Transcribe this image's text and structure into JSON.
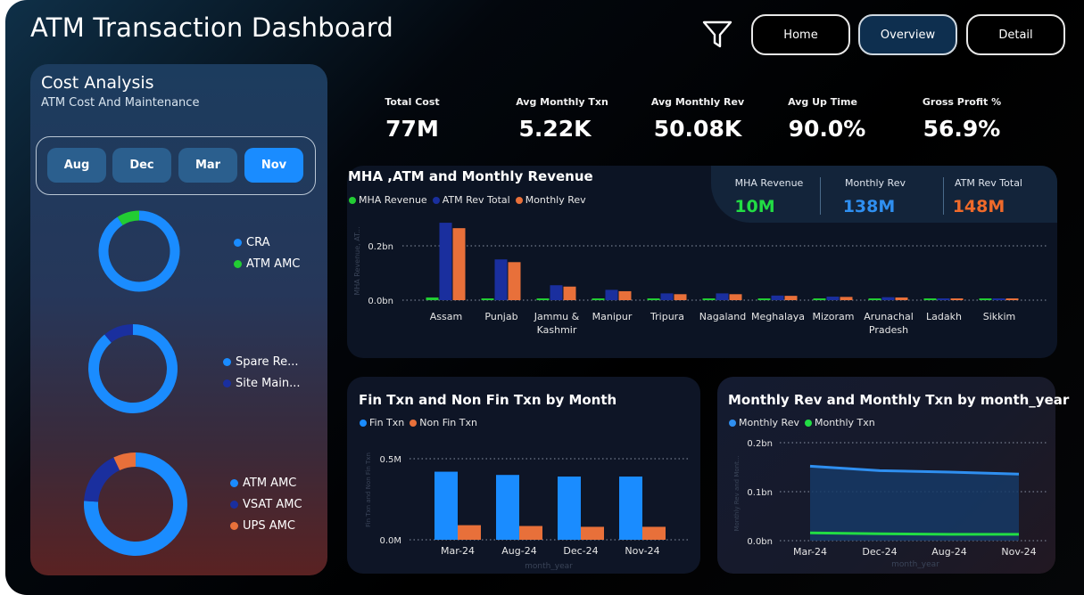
{
  "header": {
    "title": "ATM Transaction Dashboard",
    "filter_icon": "filter-icon",
    "nav": [
      {
        "label": "Home",
        "active": false
      },
      {
        "label": "Overview",
        "active": true
      },
      {
        "label": "Detail",
        "active": false
      }
    ]
  },
  "cost_panel": {
    "title": "Cost Analysis",
    "subtitle": "ATM Cost And Maintenance",
    "months": [
      {
        "label": "Aug",
        "selected": false
      },
      {
        "label": "Dec",
        "selected": false
      },
      {
        "label": "Mar",
        "selected": false
      },
      {
        "label": "Nov",
        "selected": true
      }
    ],
    "donuts": [
      {
        "legend": [
          {
            "label": "CRA",
            "color": "#1a8cff"
          },
          {
            "label": "ATM AMC",
            "color": "#22cc33"
          }
        ],
        "slices": [
          {
            "label": "CRA",
            "value": 0.91,
            "color": "#1a8cff"
          },
          {
            "label": "ATM AMC",
            "value": 0.09,
            "color": "#22cc33"
          }
        ]
      },
      {
        "legend": [
          {
            "label": "Spare Re...",
            "color": "#1a8cff"
          },
          {
            "label": "Site Main...",
            "color": "#1a2f9e"
          }
        ],
        "slices": [
          {
            "label": "Spare Re...",
            "value": 0.89,
            "color": "#1a8cff"
          },
          {
            "label": "Site Main...",
            "value": 0.11,
            "color": "#1a2f9e"
          }
        ]
      },
      {
        "legend": [
          {
            "label": "ATM AMC",
            "color": "#1a8cff"
          },
          {
            "label": "VSAT AMC",
            "color": "#1a2f9e"
          },
          {
            "label": "UPS AMC",
            "color": "#e8703a"
          }
        ],
        "slices": [
          {
            "label": "ATM AMC",
            "value": 0.76,
            "color": "#1a8cff"
          },
          {
            "label": "VSAT AMC",
            "value": 0.17,
            "color": "#1a2f9e"
          },
          {
            "label": "UPS AMC",
            "value": 0.07,
            "color": "#e8703a"
          }
        ]
      }
    ]
  },
  "kpis": [
    {
      "label": "Total Cost",
      "value": "77M"
    },
    {
      "label": "Avg Monthly Txn",
      "value": "5.22K"
    },
    {
      "label": "Avg Monthly Rev",
      "value": "50.08K"
    },
    {
      "label": "Avg Up Time",
      "value": "90.0%"
    },
    {
      "label": "Gross Profit %",
      "value": "56.9%"
    }
  ],
  "revenue_panel": {
    "title": "MHA ,ATM and Monthly Revenue",
    "mini_kpis": [
      {
        "label": "MHA Revenue",
        "value": "10M",
        "color": "#22dd44"
      },
      {
        "label": "Monthly Rev",
        "value": "138M",
        "color": "#2f8ff0"
      },
      {
        "label": "ATM Rev Total",
        "value": "148M",
        "color": "#f06a2a"
      }
    ]
  },
  "fin_panel": {
    "title": "Fin Txn and Non Fin Txn by Month"
  },
  "monthly_panel": {
    "title": "Monthly Rev and Monthly Txn by month_year"
  },
  "chart_data": [
    {
      "type": "bar",
      "title": "MHA ,ATM and Monthly Revenue",
      "ylabel": "MHA Revenue, AT...",
      "categories": [
        "Assam",
        "Punjab",
        "Jammu & Kashmir",
        "Manipur",
        "Tripura",
        "Nagaland",
        "Meghalaya",
        "Mizoram",
        "Arunachal Pradesh",
        "Ladakh",
        "Sikkim"
      ],
      "series": [
        {
          "name": "MHA Revenue",
          "color": "#22cc33",
          "values": [
            0.01,
            0.006,
            0.002,
            0.001,
            0.001,
            0.001,
            0.001,
            0.001,
            0.001,
            0.001,
            0.001
          ]
        },
        {
          "name": "ATM Rev Total",
          "color": "#1a2f9e",
          "values": [
            0.285,
            0.15,
            0.055,
            0.038,
            0.025,
            0.025,
            0.017,
            0.013,
            0.011,
            0.003,
            0.003
          ]
        },
        {
          "name": "Monthly Rev",
          "color": "#e8703a",
          "values": [
            0.265,
            0.14,
            0.05,
            0.033,
            0.022,
            0.022,
            0.016,
            0.012,
            0.01,
            0.003,
            0.003
          ]
        }
      ],
      "yticks": [
        {
          "v": 0,
          "label": "0.0bn"
        },
        {
          "v": 0.2,
          "label": "0.2bn"
        }
      ],
      "ylim": [
        0,
        0.32
      ]
    },
    {
      "type": "bar",
      "title": "Fin Txn and Non Fin Txn by Month",
      "xlabel": "month_year",
      "ylabel": "Fin Txn and Non Fin Txn",
      "categories": [
        "Mar-24",
        "Aug-24",
        "Dec-24",
        "Nov-24"
      ],
      "series": [
        {
          "name": "Fin Txn",
          "color": "#1a8cff",
          "values": [
            0.42,
            0.4,
            0.39,
            0.39
          ]
        },
        {
          "name": "Non Fin Txn",
          "color": "#e8703a",
          "values": [
            0.09,
            0.085,
            0.08,
            0.08
          ]
        }
      ],
      "yticks": [
        {
          "v": 0,
          "label": "0.0M"
        },
        {
          "v": 0.5,
          "label": "0.5M"
        }
      ],
      "ylim": [
        0,
        0.62
      ]
    },
    {
      "type": "area",
      "title": "Monthly Rev and Monthly Txn by month_year",
      "xlabel": "month_year",
      "ylabel": "Monthly Rev and Mont...",
      "categories": [
        "Mar-24",
        "Dec-24",
        "Aug-24",
        "Nov-24"
      ],
      "series": [
        {
          "name": "Monthly Rev",
          "color": "#2f8ff0",
          "values": [
            0.152,
            0.143,
            0.14,
            0.136
          ]
        },
        {
          "name": "Monthly Txn",
          "color": "#22dd44",
          "values": [
            0.016,
            0.014,
            0.013,
            0.013
          ]
        }
      ],
      "yticks": [
        {
          "v": 0,
          "label": "0.0bn"
        },
        {
          "v": 0.1,
          "label": "0.1bn"
        },
        {
          "v": 0.2,
          "label": "0.2bn"
        }
      ],
      "ylim": [
        0,
        0.2
      ]
    }
  ]
}
